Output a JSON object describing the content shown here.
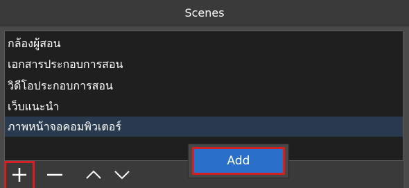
{
  "dock": {
    "title": "Scenes"
  },
  "scenes": {
    "items": [
      {
        "label": "กล้องผู้สอน"
      },
      {
        "label": "เอกสารประกอบการสอน"
      },
      {
        "label": "วิดีโอประกอบการสอน"
      },
      {
        "label": "เว็บแนะนำ"
      },
      {
        "label": "ภาพหน้าจอคอมพิวเตอร์",
        "selected": true
      }
    ]
  },
  "toolbar": {
    "buttons": [
      {
        "icon": "plus-icon"
      },
      {
        "icon": "minus-icon"
      },
      {
        "icon": "chevron-up-icon"
      },
      {
        "icon": "chevron-down-icon"
      }
    ]
  },
  "context_menu": {
    "items": [
      {
        "label": "Add",
        "highlighted": true
      }
    ]
  },
  "colors": {
    "highlight_border": "#d42025",
    "menu_selection": "#2a6fc9",
    "list_selection": "#2a3a4e"
  }
}
